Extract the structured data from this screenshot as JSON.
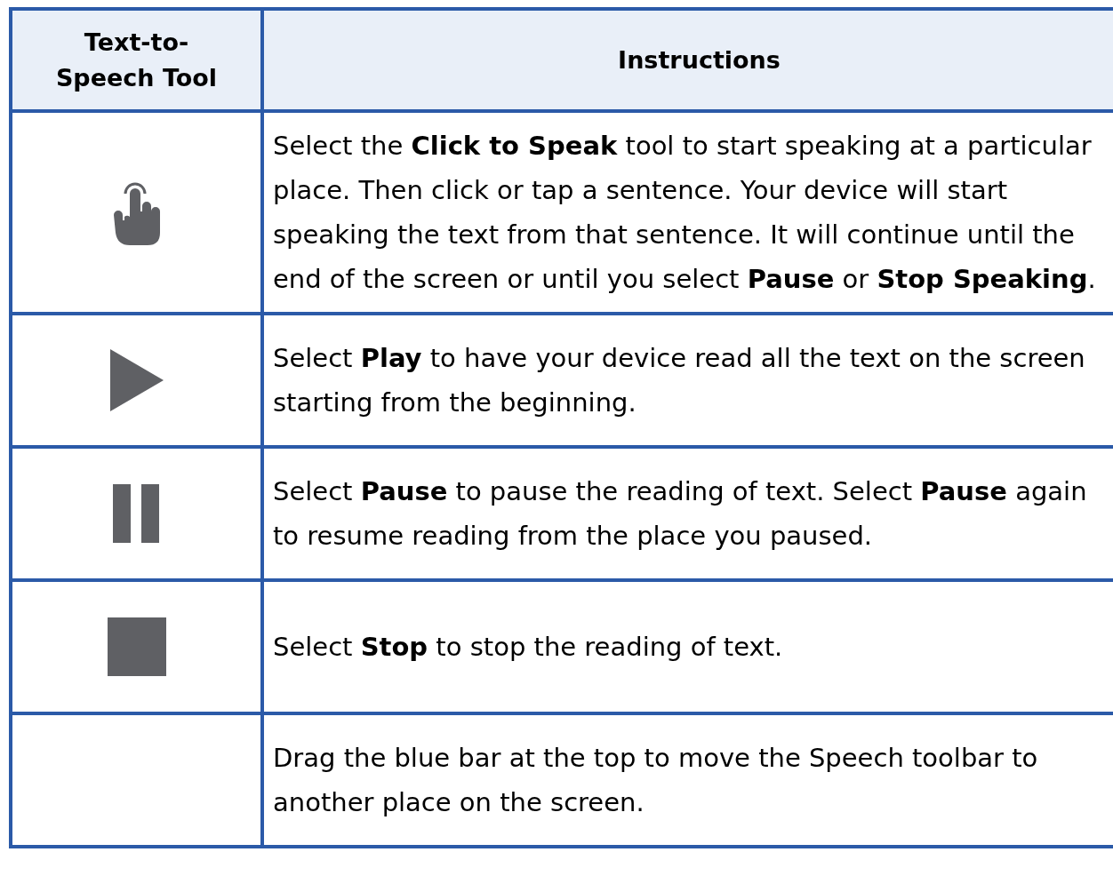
{
  "table": {
    "columns": [
      "Text-to-Speech Tool",
      "Instructions"
    ],
    "rows": [
      {
        "kind": "pointer",
        "instruction": "Select the **Click to Speak** tool to start speaking at a particular place. Then click or tap a sentence. Your device will start speaking the text from that sentence. It will continue until the end of the screen or until you select **Pause** or **Stop Speaking**."
      },
      {
        "kind": "play",
        "instruction": "Select **Play** to have your device read all the text on the screen starting from the beginning."
      },
      {
        "kind": "pause",
        "instruction": "Select **Pause** to pause the reading of text. Select **Pause** again to resume reading from the place you paused."
      },
      {
        "kind": "stop",
        "instruction": "Select **Stop** to stop the reading of text."
      },
      {
        "kind": "text",
        "instruction": "Drag the blue bar at the top to move the Speech toolbar to another place on the screen."
      }
    ]
  }
}
